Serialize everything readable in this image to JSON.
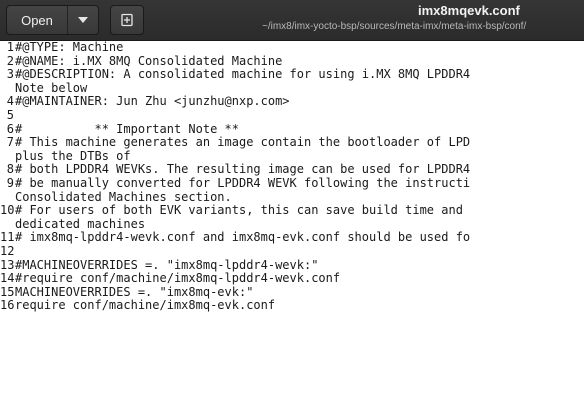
{
  "app": {
    "open_label": "Open",
    "title": "imx8mqevk.conf",
    "path": "~/imx8/imx-yocto-bsp/sources/meta-imx/meta-imx-bsp/conf/"
  },
  "icons": {
    "open_menu": "chevron-down-icon",
    "pin": "pin-icon"
  },
  "colors": {
    "headerbar": "#2f2f2f",
    "editor_bg": "#ffffff",
    "text": "#1a1a1a"
  },
  "editor": {
    "lines": [
      {
        "num": "1",
        "segments": [
          "#@TYPE: Machine"
        ]
      },
      {
        "num": "2",
        "segments": [
          "#@NAME: i.MX 8MQ Consolidated Machine"
        ]
      },
      {
        "num": "3",
        "segments": [
          "#@DESCRIPTION: A consolidated machine for using i.MX 8MQ LPDDR4",
          "Note below"
        ]
      },
      {
        "num": "4",
        "segments": [
          "#@MAINTAINER: Jun Zhu <junzhu@nxp.com>"
        ]
      },
      {
        "num": "5",
        "segments": [
          ""
        ]
      },
      {
        "num": "6",
        "segments": [
          "#          ** Important Note **"
        ]
      },
      {
        "num": "7",
        "segments": [
          "# This machine generates an image contain the bootloader of LPD",
          "plus the DTBs of"
        ]
      },
      {
        "num": "8",
        "segments": [
          "# both LPDDR4 WEVKs. The resulting image can be used for LPDDR4"
        ]
      },
      {
        "num": "9",
        "segments": [
          "# be manually converted for LPDDR4 WEVK following the instructi",
          "Consolidated Machines section."
        ]
      },
      {
        "num": "10",
        "segments": [
          "# For users of both EVK variants, this can save build time and",
          "dedicated machines"
        ]
      },
      {
        "num": "11",
        "segments": [
          "# imx8mq-lpddr4-wevk.conf and imx8mq-evk.conf should be used fo"
        ]
      },
      {
        "num": "12",
        "segments": [
          ""
        ]
      },
      {
        "num": "13",
        "segments": [
          "#MACHINEOVERRIDES =. \"imx8mq-lpddr4-wevk:\""
        ]
      },
      {
        "num": "14",
        "segments": [
          "#require conf/machine/imx8mq-lpddr4-wevk.conf"
        ]
      },
      {
        "num": "15",
        "segments": [
          "MACHINEOVERRIDES =. \"imx8mq-evk:\""
        ]
      },
      {
        "num": "16",
        "segments": [
          "require conf/machine/imx8mq-evk.conf"
        ]
      }
    ]
  }
}
